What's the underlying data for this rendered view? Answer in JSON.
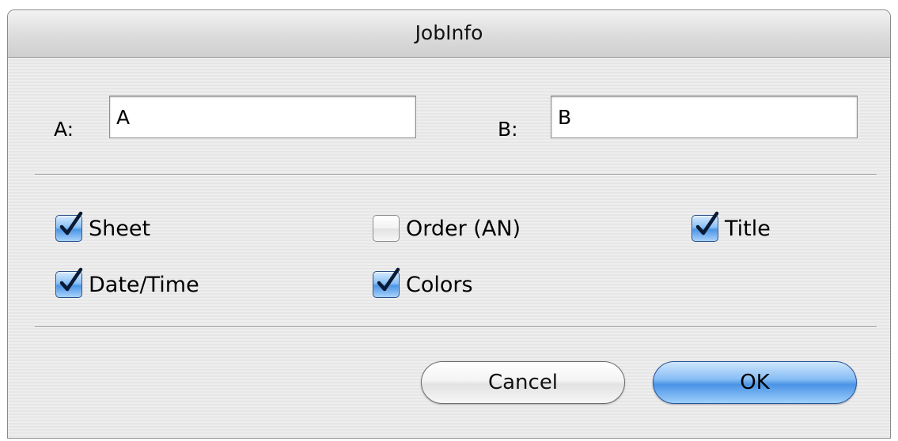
{
  "window": {
    "title": "JobInfo"
  },
  "fields": {
    "a": {
      "label": "A:",
      "value": "A"
    },
    "b": {
      "label": "B:",
      "value": "B"
    }
  },
  "options": {
    "sheet": {
      "label": "Sheet",
      "checked": true
    },
    "order": {
      "label": "Order (AN)",
      "checked": false
    },
    "title": {
      "label": "Title",
      "checked": true
    },
    "date_time": {
      "label": "Date/Time",
      "checked": true
    },
    "colors": {
      "label": "Colors",
      "checked": true
    }
  },
  "buttons": {
    "cancel_label": "Cancel",
    "ok_label": "OK"
  },
  "colors": {
    "accent": "#4a93e6",
    "checkmark": "#0b1a33"
  }
}
